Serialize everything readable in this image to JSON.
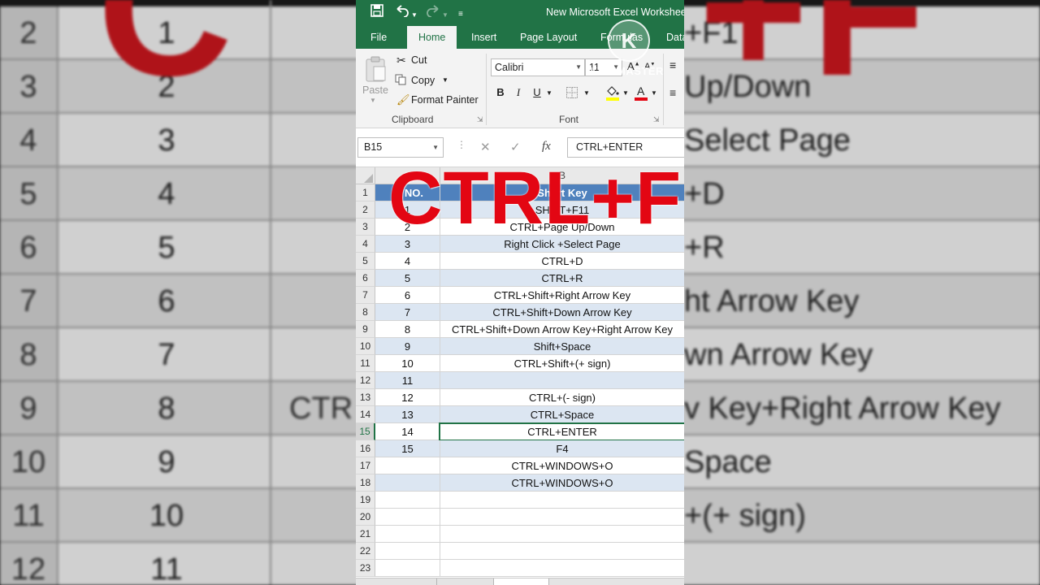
{
  "app": {
    "title": "New Microsoft Excel Workshee",
    "qat": {
      "save_icon": "save-icon",
      "undo_icon": "undo-icon",
      "redo_icon": "redo-icon",
      "customize_icon": "customize-qat-icon"
    },
    "accent_color": "#217346"
  },
  "tabs": [
    "File",
    "Home",
    "Insert",
    "Page Layout",
    "Formulas",
    "Data"
  ],
  "ribbon": {
    "clipboard": {
      "label": "Clipboard",
      "paste": "Paste",
      "cut": "Cut",
      "copy": "Copy",
      "format_painter": "Format Painter"
    },
    "font": {
      "label": "Font",
      "font_name": "Calibri",
      "font_size": "11",
      "bold": "B",
      "italic": "I",
      "underline": "U"
    }
  },
  "formula_bar": {
    "name_box": "B15",
    "fx": "fx",
    "content": "CTRL+ENTER"
  },
  "sheet": {
    "col_b_header": "B",
    "header_row": {
      "a": "S. NO.",
      "b": "Short Key"
    },
    "rows": [
      {
        "rn": "1",
        "a": "S. NO.",
        "b": "Short Key"
      },
      {
        "rn": "2",
        "a": "1",
        "b": "SHIFT+F11"
      },
      {
        "rn": "3",
        "a": "2",
        "b": "CTRL+Page Up/Down"
      },
      {
        "rn": "4",
        "a": "3",
        "b": "Right Click +Select Page"
      },
      {
        "rn": "5",
        "a": "4",
        "b": "CTRL+D"
      },
      {
        "rn": "6",
        "a": "5",
        "b": "CTRL+R"
      },
      {
        "rn": "7",
        "a": "6",
        "b": "CTRL+Shift+Right Arrow Key"
      },
      {
        "rn": "8",
        "a": "7",
        "b": "CTRL+Shift+Down Arrow Key"
      },
      {
        "rn": "9",
        "a": "8",
        "b": "CTRL+Shift+Down Arrow Key+Right Arrow Key"
      },
      {
        "rn": "10",
        "a": "9",
        "b": "Shift+Space"
      },
      {
        "rn": "11",
        "a": "10",
        "b": "CTRL+Shift+(+ sign)"
      },
      {
        "rn": "12",
        "a": "11",
        "b": ""
      },
      {
        "rn": "13",
        "a": "12",
        "b": "CTRL+(- sign)"
      },
      {
        "rn": "14",
        "a": "13",
        "b": "CTRL+Space"
      },
      {
        "rn": "15",
        "a": "14",
        "b": "CTRL+ENTER"
      },
      {
        "rn": "16",
        "a": "15",
        "b": "F4"
      },
      {
        "rn": "17",
        "a": "",
        "b": "CTRL+WINDOWS+O"
      },
      {
        "rn": "18",
        "a": "",
        "b": "CTRL+WINDOWS+O"
      },
      {
        "rn": "19",
        "a": "",
        "b": ""
      },
      {
        "rn": "20",
        "a": "",
        "b": ""
      },
      {
        "rn": "21",
        "a": "",
        "b": ""
      },
      {
        "rn": "22",
        "a": "",
        "b": ""
      },
      {
        "rn": "23",
        "a": "",
        "b": ""
      }
    ],
    "header_color": "#4f81bd",
    "band_color": "#dce6f2"
  },
  "overlay_text": "CTRL+F",
  "watermark": "KINEMASTER",
  "background": {
    "row_numbers": [
      "2",
      "3",
      "4",
      "5",
      "6",
      "7",
      "8",
      "9",
      "10",
      "11",
      "12"
    ],
    "numbers": [
      "1",
      "2",
      "3",
      "4",
      "5",
      "6",
      "7",
      "8",
      "9",
      "10",
      "11"
    ],
    "keys": [
      "+F1",
      "Up/Down",
      "Select Page",
      "+D",
      "+R",
      "ht Arrow Key",
      "wn Arrow Key",
      "v Key+Right Arrow Key",
      "Space",
      "+(+ sign)",
      ""
    ],
    "extra": "CTR",
    "red_left": "C",
    "red_right": "+F"
  }
}
